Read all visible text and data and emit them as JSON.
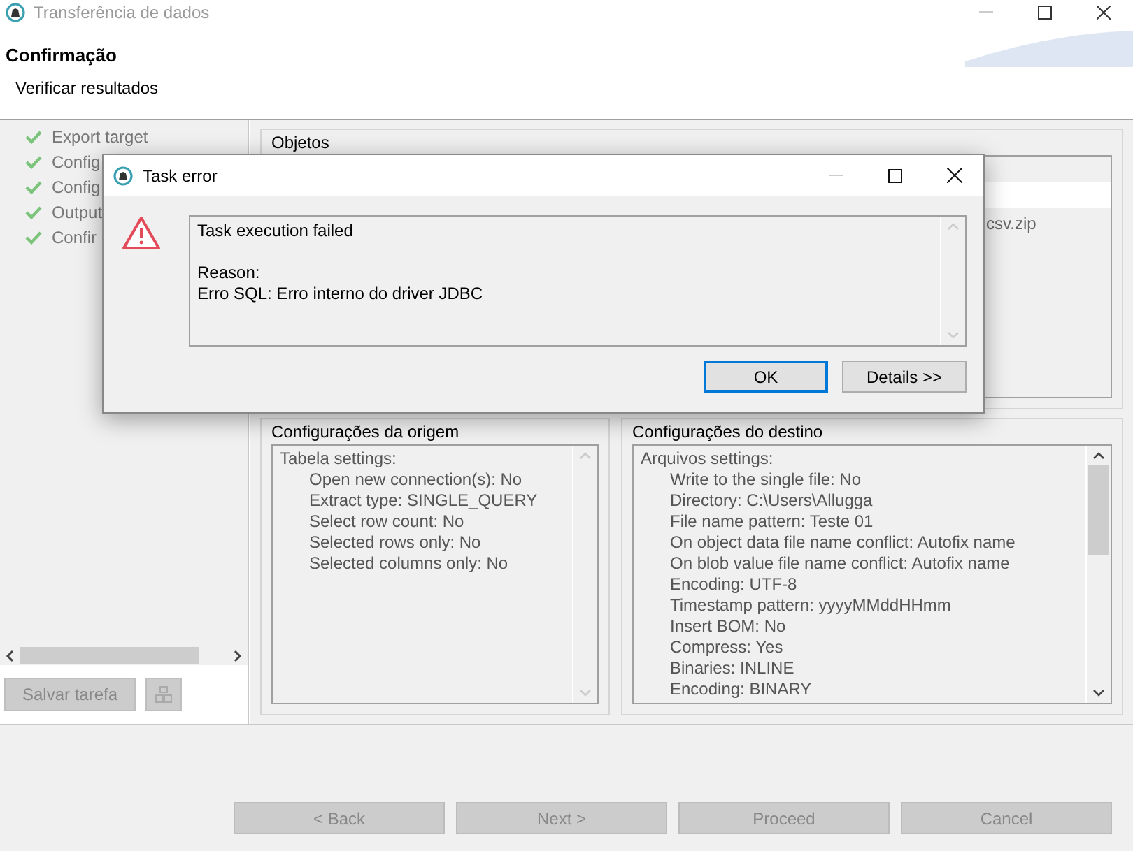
{
  "window": {
    "title": "Transferência de dados"
  },
  "header": {
    "title": "Confirmação",
    "subtitle": "Verificar resultados"
  },
  "steps": [
    {
      "label": "Export target",
      "done": true
    },
    {
      "label": "Config",
      "done": true
    },
    {
      "label": "Config",
      "done": true
    },
    {
      "label": "Output",
      "done": true
    },
    {
      "label": "Confir",
      "done": true
    }
  ],
  "save_button": {
    "label": "Salvar tarefa",
    "disabled": true
  },
  "objects": {
    "title": "Objetos",
    "rows": [
      {
        "column_2": "csv.zip"
      }
    ]
  },
  "source": {
    "title": "Configurações da origem",
    "heading": "Tabela settings:",
    "items": [
      "Open new connection(s): No",
      "Extract type: SINGLE_QUERY",
      "Select row count: No",
      "Selected rows only: No",
      "Selected columns only: No"
    ]
  },
  "target": {
    "title": "Configurações do destino",
    "heading": "Arquivos settings:",
    "items": [
      "Write to the single file: No",
      "Directory: C:\\Users\\Allugga",
      "File name pattern: Teste 01",
      "On object data file name conflict: Autofix name",
      "On blob value file name conflict: Autofix name",
      "Encoding: UTF-8",
      "Timestamp pattern: yyyyMMddHHmm",
      "Insert BOM: No",
      "Compress: Yes",
      "Binaries: INLINE",
      "Encoding: BINARY"
    ]
  },
  "footer_buttons": [
    {
      "label": "< Back",
      "disabled": true
    },
    {
      "label": "Next >",
      "disabled": true
    },
    {
      "label": "Proceed",
      "disabled": true
    },
    {
      "label": "Cancel",
      "disabled": true
    }
  ],
  "dialog": {
    "title": "Task error",
    "message": "Task execution failed",
    "reason_label": "Reason:",
    "reason": "Erro SQL: Erro interno do driver JDBC",
    "buttons": [
      {
        "label": "OK",
        "default": true
      },
      {
        "label": "Details >>",
        "default": false
      }
    ]
  }
}
